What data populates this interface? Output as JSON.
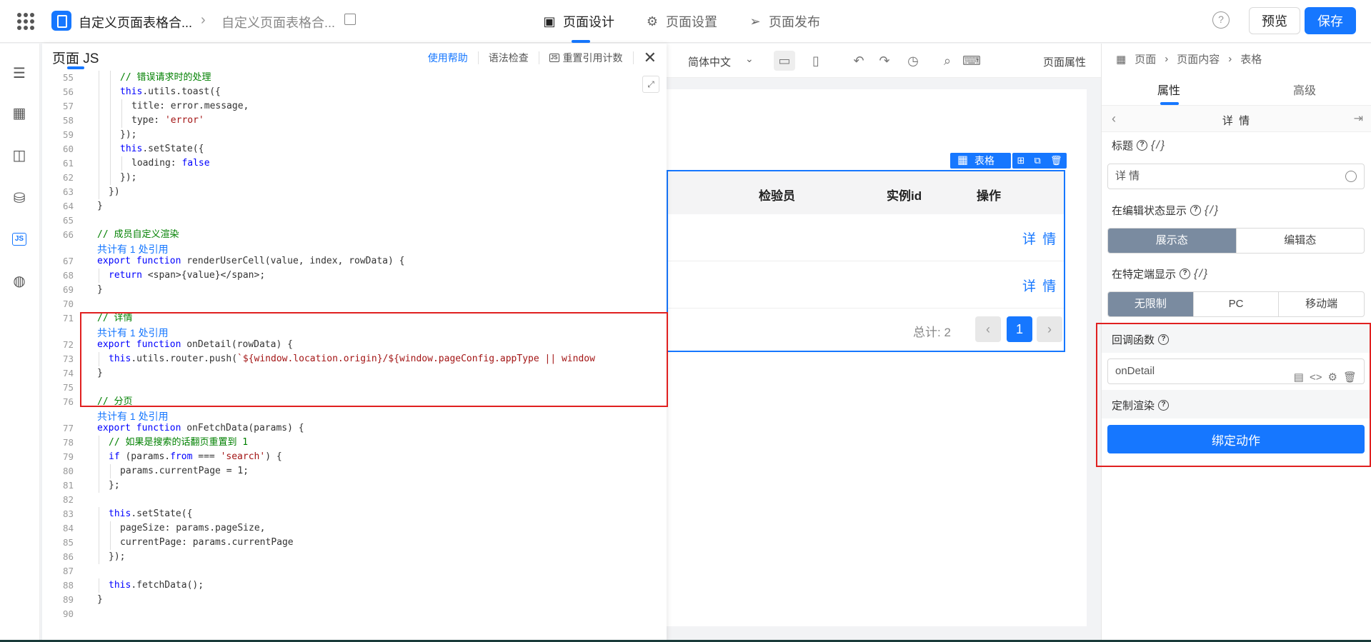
{
  "header": {
    "app_name": "自定义页面表格合...",
    "breadcrumb_sep": "›",
    "page_name": "自定义页面表格合...",
    "tabs": [
      {
        "label": "页面设计",
        "icon": "page-design-icon",
        "active": true
      },
      {
        "label": "页面设置",
        "icon": "gear-icon",
        "active": false
      },
      {
        "label": "页面发布",
        "icon": "send-icon",
        "active": false
      }
    ],
    "help_glyph": "?",
    "preview_label": "预览",
    "save_label": "保存"
  },
  "code_panel": {
    "title": "页面 JS",
    "actions": {
      "help": "使用帮助",
      "lint": "语法检查",
      "js_badge": "JS",
      "reset_refs": "重置引用计数",
      "close": "✕"
    },
    "lines": [
      {
        "n": "55",
        "indent": 2,
        "html": "<span class='cmt'>// 错误请求时的处理</span>"
      },
      {
        "n": "56",
        "indent": 2,
        "html": "<span class='kw'>this</span>.utils.toast({"
      },
      {
        "n": "57",
        "indent": 3,
        "html": "title: error.message,"
      },
      {
        "n": "58",
        "indent": 3,
        "html": "type: <span class='str'>'error'</span>"
      },
      {
        "n": "59",
        "indent": 2,
        "html": "});"
      },
      {
        "n": "60",
        "indent": 2,
        "html": "<span class='kw'>this</span>.setState({"
      },
      {
        "n": "61",
        "indent": 3,
        "html": "loading: <span class='kw'>false</span>"
      },
      {
        "n": "62",
        "indent": 2,
        "html": "});"
      },
      {
        "n": "63",
        "indent": 1,
        "html": "})"
      },
      {
        "n": "64",
        "indent": 0,
        "html": "}"
      },
      {
        "n": "65",
        "indent": 0,
        "html": ""
      },
      {
        "n": "66",
        "indent": 0,
        "html": "<span class='cmt'>// 成员自定义渲染</span>"
      },
      {
        "ref": "共计有 1 处引用"
      },
      {
        "n": "67",
        "indent": 0,
        "html": "<span class='kw'>export function</span> renderUserCell(value, index, rowData) {"
      },
      {
        "n": "68",
        "indent": 1,
        "html": "<span class='kw'>return</span> &lt;span&gt;{value}&lt;/span&gt;;"
      },
      {
        "n": "69",
        "indent": 0,
        "html": "}"
      },
      {
        "n": "70",
        "indent": 0,
        "html": ""
      },
      {
        "n": "71",
        "indent": 0,
        "html": "<span class='cmt'>// 详情</span>"
      },
      {
        "ref": "共计有 1 处引用"
      },
      {
        "n": "72",
        "indent": 0,
        "html": "<span class='kw'>export function</span> onDetail(rowData) {"
      },
      {
        "n": "73",
        "indent": 1,
        "html": "<span class='kw'>this</span>.utils.router.push(<span class='str'>`${window.location.origin}/${window.pageConfig.appType || window</span>"
      },
      {
        "n": "74",
        "indent": 0,
        "html": "}"
      },
      {
        "n": "75",
        "indent": 0,
        "html": ""
      },
      {
        "n": "76",
        "indent": 0,
        "html": "<span class='cmt'>// 分页</span>"
      },
      {
        "ref": "共计有 1 处引用"
      },
      {
        "n": "77",
        "indent": 0,
        "html": "<span class='kw'>export function</span> onFetchData(params) {"
      },
      {
        "n": "78",
        "indent": 1,
        "html": "<span class='cmt'>// 如果是搜索的话翻页重置到 1</span>"
      },
      {
        "n": "79",
        "indent": 1,
        "html": "<span class='kw'>if</span> (params.<span class='kw'>from</span> === <span class='str'>'search'</span>) {"
      },
      {
        "n": "80",
        "indent": 2,
        "html": "params.currentPage = 1;"
      },
      {
        "n": "81",
        "indent": 1,
        "html": "};"
      },
      {
        "n": "82",
        "indent": 0,
        "html": ""
      },
      {
        "n": "83",
        "indent": 1,
        "html": "<span class='kw'>this</span>.setState({"
      },
      {
        "n": "84",
        "indent": 2,
        "html": "pageSize: params.pageSize,"
      },
      {
        "n": "85",
        "indent": 2,
        "html": "currentPage: params.currentPage"
      },
      {
        "n": "86",
        "indent": 1,
        "html": "});"
      },
      {
        "n": "87",
        "indent": 0,
        "html": ""
      },
      {
        "n": "88",
        "indent": 1,
        "html": "<span class='kw'>this</span>.fetchData();"
      },
      {
        "n": "89",
        "indent": 0,
        "html": "}"
      },
      {
        "n": "90",
        "indent": 0,
        "html": ""
      }
    ]
  },
  "canvas": {
    "lang": "简体中文",
    "page_props": "页面属性",
    "table_tag": "表格",
    "columns": [
      "检验员",
      "实例id",
      "操作"
    ],
    "row_action": "详 情",
    "rows": 2,
    "total_label": "总计: 2",
    "current_page": "1",
    "prev": "‹",
    "next": "›"
  },
  "right_panel": {
    "breadcrumb": [
      "页面",
      "页面内容",
      "表格"
    ],
    "tabs": [
      "属性",
      "高级"
    ],
    "sub_title": "详 情",
    "title_label": "标题",
    "title_value": "详 情",
    "edit_state_label": "在编辑状态显示",
    "edit_state_options": [
      "展示态",
      "编辑态"
    ],
    "edit_state_selected": "展示态",
    "device_label": "在特定端显示",
    "device_options": [
      "无限制",
      "PC",
      "移动端"
    ],
    "device_selected": "无限制",
    "callback_label": "回调函数",
    "callback_value": "onDetail",
    "custom_render_label": "定制渲染",
    "bind_action_label": "绑定动作",
    "var_glyph": "{/}",
    "help_glyph": "?"
  },
  "colors": {
    "accent": "#1677ff",
    "highlight_border": "#e02020",
    "segment_selected": "#7a8ba0"
  }
}
